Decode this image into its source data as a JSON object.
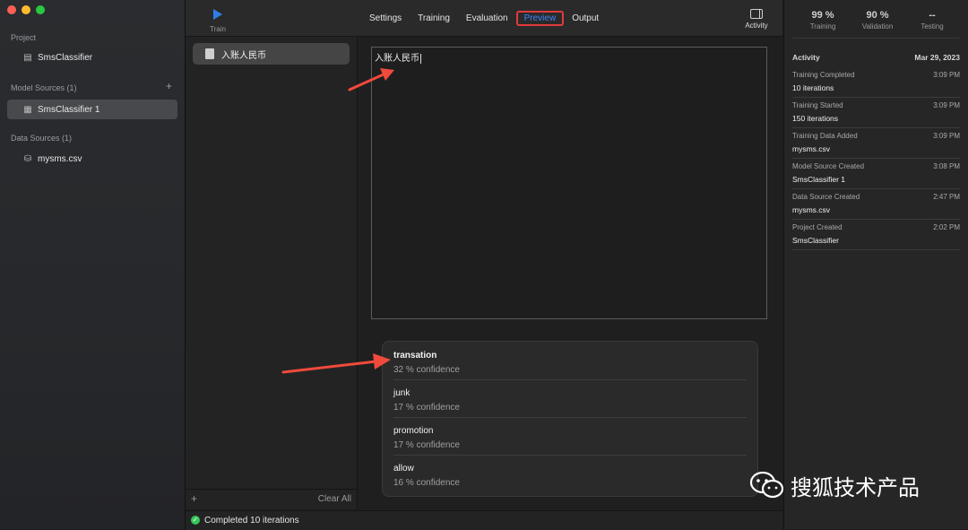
{
  "sidebar": {
    "project_header": "Project",
    "project_name": "SmsClassifier",
    "model_sources_header": "Model Sources (1)",
    "model_source_item": "SmsClassifier 1",
    "data_sources_header": "Data Sources (1)",
    "data_source_item": "mysms.csv"
  },
  "toolbar": {
    "train_label": "Train",
    "tabs": [
      "Settings",
      "Training",
      "Evaluation",
      "Preview",
      "Output"
    ],
    "active_tab": "Preview",
    "activity_label": "Activity"
  },
  "list": {
    "item": "入账人民币",
    "clear_all": "Clear All"
  },
  "preview": {
    "input_text": "入账人民币",
    "results": [
      {
        "label": "transation",
        "confidence": "32 % confidence"
      },
      {
        "label": "junk",
        "confidence": "17 % confidence"
      },
      {
        "label": "promotion",
        "confidence": "17 % confidence"
      },
      {
        "label": "allow",
        "confidence": "16 % confidence"
      }
    ]
  },
  "status": {
    "text": "Completed 10 iterations"
  },
  "metrics": [
    {
      "value": "99 %",
      "label": "Training"
    },
    {
      "value": "90 %",
      "label": "Validation"
    },
    {
      "value": "--",
      "label": "Testing"
    }
  ],
  "activity": {
    "header": "Activity",
    "date": "Mar 29, 2023",
    "rows": [
      {
        "title": "Training Completed",
        "time": "3:09 PM",
        "detail": "10 iterations"
      },
      {
        "title": "Training Started",
        "time": "3:09 PM",
        "detail": "150 iterations"
      },
      {
        "title": "Training Data Added",
        "time": "3:09 PM",
        "detail": "mysms.csv"
      },
      {
        "title": "Model Source Created",
        "time": "3:08 PM",
        "detail": "SmsClassifier 1"
      },
      {
        "title": "Data Source Created",
        "time": "2:47 PM",
        "detail": "mysms.csv"
      },
      {
        "title": "Project Created",
        "time": "2:02 PM",
        "detail": "SmsClassifier"
      }
    ]
  },
  "watermark": {
    "text": "搜狐技术产品"
  },
  "colors": {
    "accent": "#3a86ff",
    "highlight_box": "#e23b3b",
    "arrow": "#f04a3c",
    "success": "#34c759"
  }
}
